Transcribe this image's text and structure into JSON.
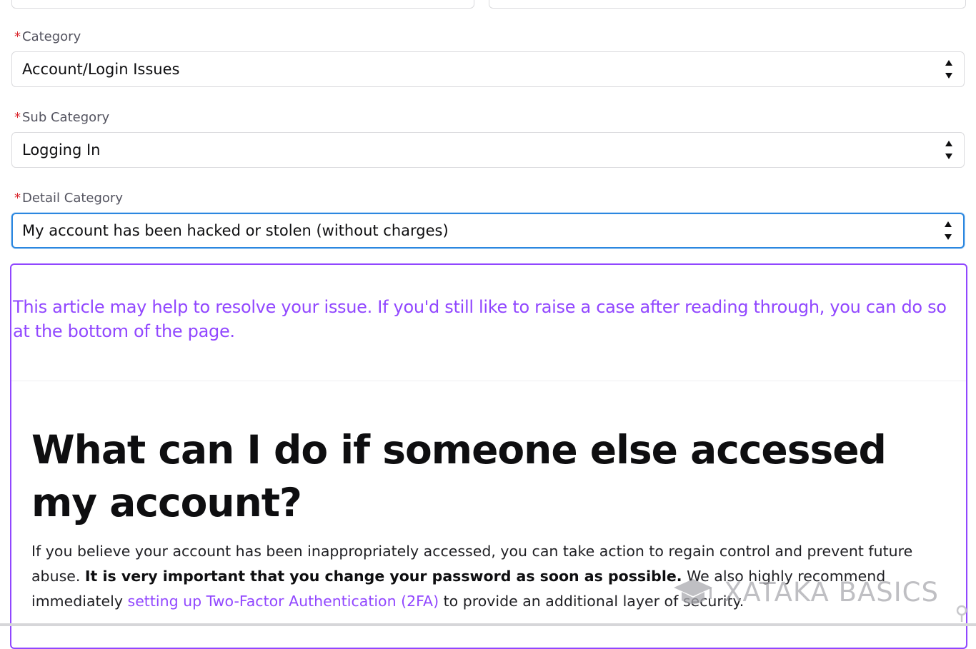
{
  "form": {
    "category": {
      "label": "Category",
      "value": "Account/Login Issues"
    },
    "sub_category": {
      "label": "Sub Category",
      "value": "Logging In"
    },
    "detail_category": {
      "label": "Detail Category",
      "value": "My account has been hacked or stolen (without charges)"
    },
    "required_mark": "*"
  },
  "article": {
    "notice": "This article may help to resolve your issue. If you'd still like to raise a case after reading through, you can do so at the bottom of the page.",
    "title": "What can I do if someone else accessed my account?",
    "body_part1": "If you believe your account has been inappropriately accessed, you can take action to regain control and prevent future abuse. ",
    "body_bold": "It is very important that you change your password as soon as possible.",
    "body_part2": " We also highly recommend immediately ",
    "body_link": "setting up Two-Factor Authentication (2FA)",
    "body_part3": " to provide an additional layer of security."
  },
  "watermark": {
    "text": "XATAKA BASICS",
    "icon": "graduation-cap-icon"
  },
  "colors": {
    "accent": "#9147ff",
    "focus": "#2b87e0",
    "required": "#d9262c"
  }
}
